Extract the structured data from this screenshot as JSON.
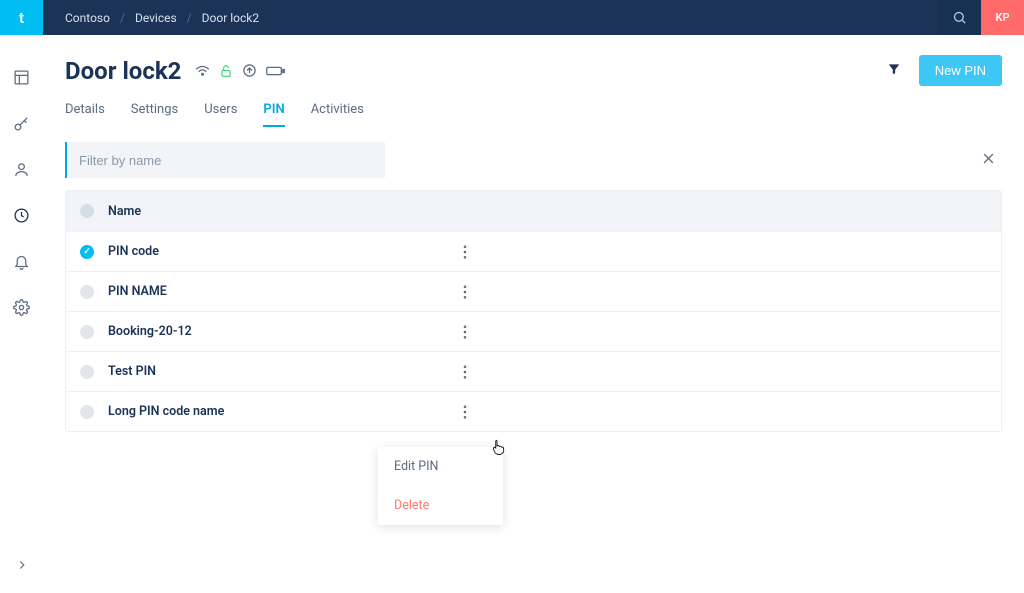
{
  "topbar": {
    "logo_letter": "t",
    "breadcrumbs": [
      "Contoso",
      "Devices",
      "Door lock2"
    ],
    "avatar_initials": "KP"
  },
  "page": {
    "title": "Door lock2",
    "new_pin_label": "New PIN"
  },
  "tabs": [
    {
      "label": "Details",
      "active": false
    },
    {
      "label": "Settings",
      "active": false
    },
    {
      "label": "Users",
      "active": false
    },
    {
      "label": "PIN",
      "active": true
    },
    {
      "label": "Activities",
      "active": false
    }
  ],
  "filter": {
    "placeholder": "Filter by name",
    "value": ""
  },
  "table": {
    "header_name": "Name",
    "rows": [
      {
        "name": "PIN code",
        "checked": true
      },
      {
        "name": "PIN NAME",
        "checked": false
      },
      {
        "name": "Booking-20-12",
        "checked": false
      },
      {
        "name": "Test PIN",
        "checked": false
      },
      {
        "name": "Long PIN code name",
        "checked": false
      }
    ]
  },
  "context_menu": {
    "edit_label": "Edit PIN",
    "delete_label": "Delete"
  },
  "status_icons": [
    "wifi-icon",
    "lock-open-icon",
    "arrow-up-circle-icon",
    "battery-icon"
  ]
}
